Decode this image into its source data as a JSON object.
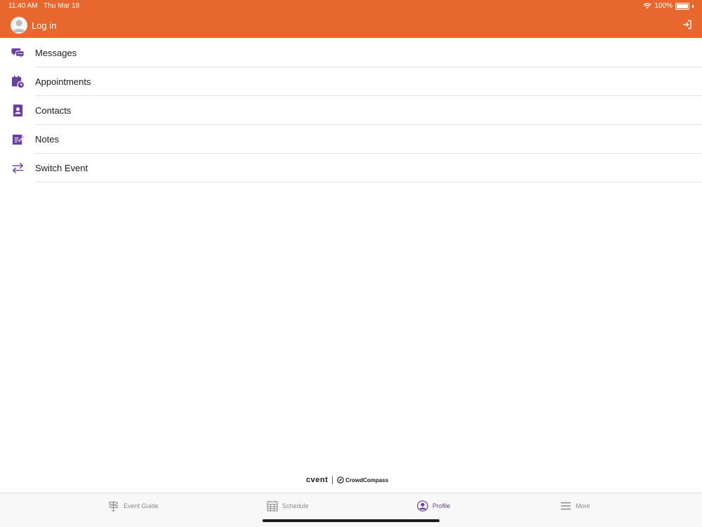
{
  "status_bar": {
    "time": "11:40 AM",
    "date": "Thu Mar 18",
    "battery": "100%"
  },
  "header": {
    "login_label": "Log in"
  },
  "menu": {
    "items": [
      {
        "label": "Messages",
        "icon": "messages-icon"
      },
      {
        "label": "Appointments",
        "icon": "appointments-icon"
      },
      {
        "label": "Contacts",
        "icon": "contacts-icon"
      },
      {
        "label": "Notes",
        "icon": "notes-icon"
      },
      {
        "label": "Switch Event",
        "icon": "switch-event-icon"
      }
    ]
  },
  "footer_brand": {
    "cvent": "cvent",
    "crowdcompass": "CrowdCompass"
  },
  "tab_bar": {
    "tabs": [
      {
        "label": "Event Guide",
        "icon": "signpost-icon",
        "active": false
      },
      {
        "label": "Schedule",
        "icon": "calendar-icon",
        "active": false
      },
      {
        "label": "Profile",
        "icon": "profile-icon",
        "active": true
      },
      {
        "label": "More",
        "icon": "hamburger-icon",
        "active": false
      }
    ]
  },
  "colors": {
    "header": "#e8672f",
    "accent": "#6a3fa0",
    "tab_inactive": "#8a8a8a"
  }
}
